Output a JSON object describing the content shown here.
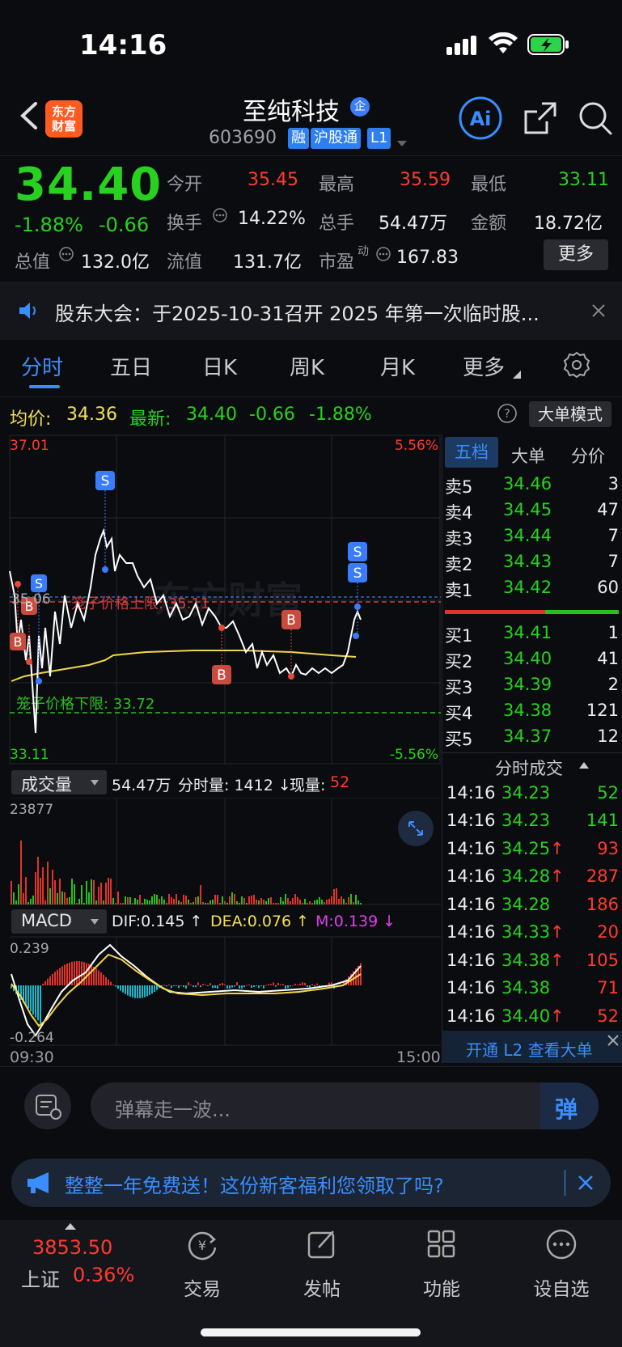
{
  "status": {
    "time": "14:16"
  },
  "header": {
    "logo_line1": "东方",
    "logo_line2": "财富",
    "name": "至纯科技",
    "name_badge": "企",
    "code": "603690",
    "tags": [
      "融",
      "沪股通",
      "L1"
    ]
  },
  "quote": {
    "price": "34.40",
    "pct": "-1.88%",
    "chg": "-0.66",
    "open_label": "今开",
    "open": "35.45",
    "high_label": "最高",
    "high": "35.59",
    "low_label": "最低",
    "low": "33.11",
    "turnover_label": "换手",
    "turnover": "14.22%",
    "volume_label": "总手",
    "volume": "54.47万",
    "amount_label": "金额",
    "amount": "18.72亿",
    "mktcap_label": "总值",
    "mktcap": "132.0亿",
    "float_label": "流值",
    "float": "131.7亿",
    "pe_label": "市盈",
    "pe_sup": "动",
    "pe": "167.83",
    "more_label": "更多"
  },
  "notice": {
    "text": "股东大会：于2025-10-31召开 2025 年第一次临时股..."
  },
  "tabs": [
    "分时",
    "五日",
    "日K",
    "周K",
    "月K",
    "更多"
  ],
  "chart_header": {
    "avg_label": "均价:",
    "avg": "34.36",
    "latest_label": "最新:",
    "latest": "34.40",
    "chg": "-0.66",
    "pct": "-1.88%",
    "mode_button": "大单模式"
  },
  "price_chart": {
    "top_price": "37.01",
    "bottom_price": "33.11",
    "mid_price": "35.06",
    "top_pct": "5.56%",
    "bottom_pct": "-5.56%",
    "upper_limit_label": "笼子价格上限: 35.11",
    "lower_limit_label": "笼子价格下限: 33.72",
    "watermark": "东方财富",
    "marker_b": "B",
    "marker_s": "S"
  },
  "volume_section": {
    "selector": "成交量",
    "total": "54.47万",
    "tick_vol_label": "分时量: 1412 ↓",
    "now_label": "现量:",
    "now_val": "52",
    "max": "23877"
  },
  "macd_section": {
    "selector": "MACD",
    "dif": "DIF:0.145 ↑",
    "dea": "DEA:0.076 ↑",
    "m": "M:0.139 ↓",
    "max": "0.239",
    "min": "-0.264"
  },
  "time_axis": {
    "start": "09:30",
    "end": "15:00"
  },
  "orderbook": {
    "tabs": [
      "五档",
      "大单",
      "分价"
    ],
    "asks": [
      {
        "label": "卖5",
        "price": "34.46",
        "vol": "3"
      },
      {
        "label": "卖4",
        "price": "34.45",
        "vol": "47"
      },
      {
        "label": "卖3",
        "price": "34.44",
        "vol": "7"
      },
      {
        "label": "卖2",
        "price": "34.43",
        "vol": "7"
      },
      {
        "label": "卖1",
        "price": "34.42",
        "vol": "60"
      }
    ],
    "bids": [
      {
        "label": "买1",
        "price": "34.41",
        "vol": "1"
      },
      {
        "label": "买2",
        "price": "34.40",
        "vol": "41"
      },
      {
        "label": "买3",
        "price": "34.39",
        "vol": "2"
      },
      {
        "label": "买4",
        "price": "34.38",
        "vol": "121"
      },
      {
        "label": "买5",
        "price": "34.37",
        "vol": "12"
      }
    ]
  },
  "ticks": {
    "title": "分时成交",
    "rows": [
      {
        "time": "14:16",
        "price": "34.23",
        "vol": "52",
        "up": ""
      },
      {
        "time": "14:16",
        "price": "34.23",
        "vol": "141",
        "up": ""
      },
      {
        "time": "14:16",
        "price": "34.25",
        "vol": "93",
        "up": "↑"
      },
      {
        "time": "14:16",
        "price": "34.28",
        "vol": "287",
        "up": "↑"
      },
      {
        "time": "14:16",
        "price": "34.28",
        "vol": "186",
        "up": ""
      },
      {
        "time": "14:16",
        "price": "34.33",
        "vol": "20",
        "up": "↑"
      },
      {
        "time": "14:16",
        "price": "34.38",
        "vol": "105",
        "up": "↑"
      },
      {
        "time": "14:16",
        "price": "34.38",
        "vol": "71",
        "up": ""
      },
      {
        "time": "14:16",
        "price": "34.40",
        "vol": "52",
        "up": "↑"
      }
    ],
    "l2_promo": "开通 L2 查看大单"
  },
  "comment": {
    "placeholder": "弹幕走一波...",
    "send": "弹"
  },
  "promo": {
    "text": "整整一年免费送！这份新客福利您领取了吗?"
  },
  "bottom_nav": {
    "index_value": "3853.50",
    "index_name": "上证",
    "index_pct": "0.36%",
    "items": [
      "交易",
      "发帖",
      "功能",
      "设自选"
    ]
  }
}
